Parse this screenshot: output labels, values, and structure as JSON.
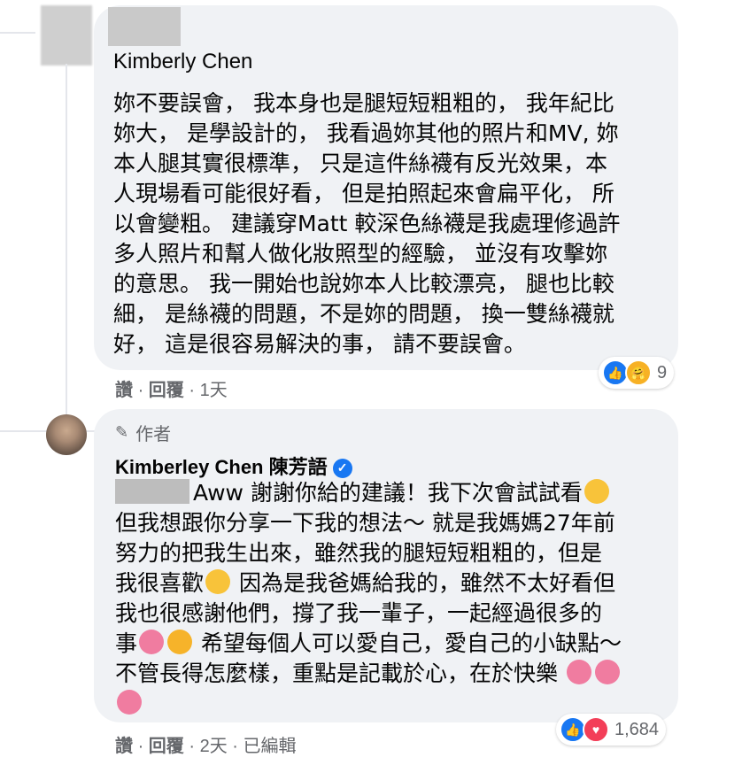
{
  "comment1": {
    "author": "Kimberly Chen",
    "lines": [
      "妳不要誤會， 我本身也是腿短短粗粗的， 我年紀比",
      "妳大， 是學設計的， 我看過妳其他的照片和MV, 妳",
      "本人腿其實很標準， 只是這件絲襪有反光效果，本",
      "人現場看可能很好看， 但是拍照起來會扁平化， 所",
      "以會變粗。 建議穿Matt 較深色絲襪是我處理修過許",
      "多人照片和幫人做化妝照型的經驗， 並沒有攻擊妳",
      "的意思。 我一開始也說妳本人比較漂亮， 腿也比較",
      "細， 是絲襪的問題，不是妳的問題， 換一雙絲襪就",
      "好， 這是很容易解決的事， 請不要誤會。"
    ],
    "actions": {
      "like": "讚",
      "reply": "回覆",
      "time": "1天"
    },
    "reactions": {
      "icons": [
        "like-icon",
        "care-icon"
      ],
      "count": "9"
    }
  },
  "comment2": {
    "badge": "作者",
    "author": "Kimberley Chen 陳芳語",
    "line1": "Aww 謝謝你給的建議！我下次會試試看",
    "lines": [
      "但我想跟你分享一下我的想法～ 就是我媽媽27年前",
      "努力的把我生出來，雖然我的腿短短粗粗的，但是",
      "我很喜歡",
      "我也很感謝他們，撐了我一輩子，一起經過很多的",
      "事",
      "不管長得怎麼樣，重點是記載於心，在於快樂 "
    ],
    "line3_tail": " 因為是我爸媽給我的，雖然不太好看但",
    "line5_tail": " 希望每個人可以愛自己，愛自己的小缺點～",
    "actions": {
      "like": "讚",
      "reply": "回覆",
      "time": "2天",
      "edited": "已編輯"
    },
    "reactions": {
      "icons": [
        "like-icon",
        "love-icon"
      ],
      "count": "1,684"
    }
  },
  "colors": {
    "bubble": "#f0f2f5",
    "meta": "#65676b",
    "like": "#1877f2",
    "love": "#f33e58"
  }
}
